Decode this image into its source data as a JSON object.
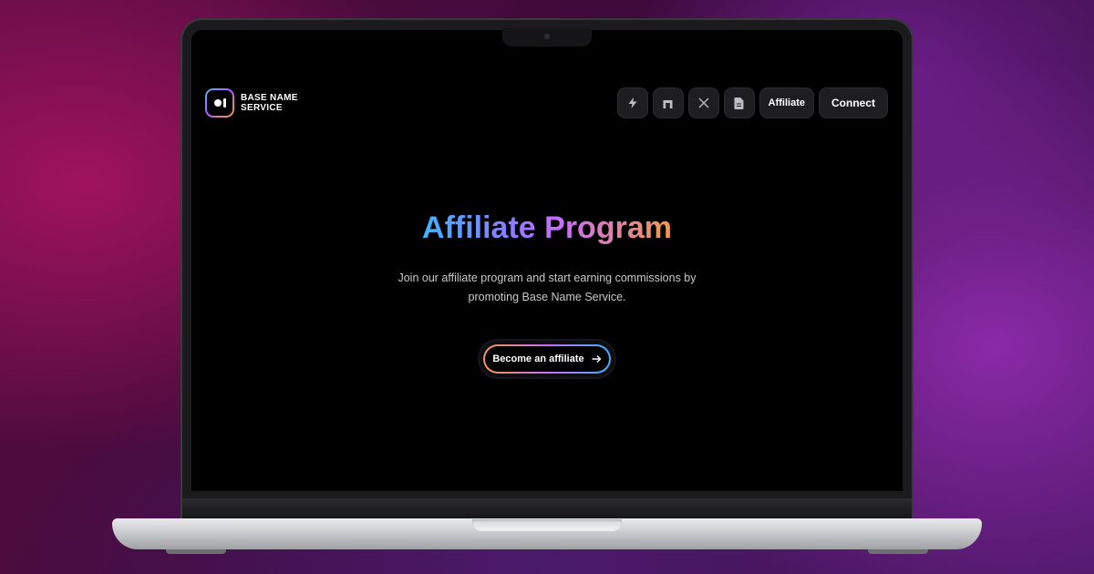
{
  "brand": {
    "line1": "BASE NAME",
    "line2": "SERVICE"
  },
  "nav": {
    "items": [
      {
        "icon": "lightning-icon"
      },
      {
        "icon": "arch-icon"
      },
      {
        "icon": "x-icon"
      },
      {
        "icon": "document-icon"
      },
      {
        "label": "Affiliate"
      },
      {
        "label": "Connect"
      }
    ]
  },
  "hero": {
    "title": "Affiliate Program",
    "subtitle": "Join our affiliate program and start earning commissions by promoting Base Name Service.",
    "cta_label": "Become an affiliate",
    "cta_icon": "arrow-right-icon"
  },
  "colors": {
    "gradient_blue": "#3fb2ff",
    "gradient_purple": "#c86cff",
    "gradient_orange": "#f19a4a",
    "screen_bg": "#000000",
    "button_bg": "#1e1e20"
  }
}
